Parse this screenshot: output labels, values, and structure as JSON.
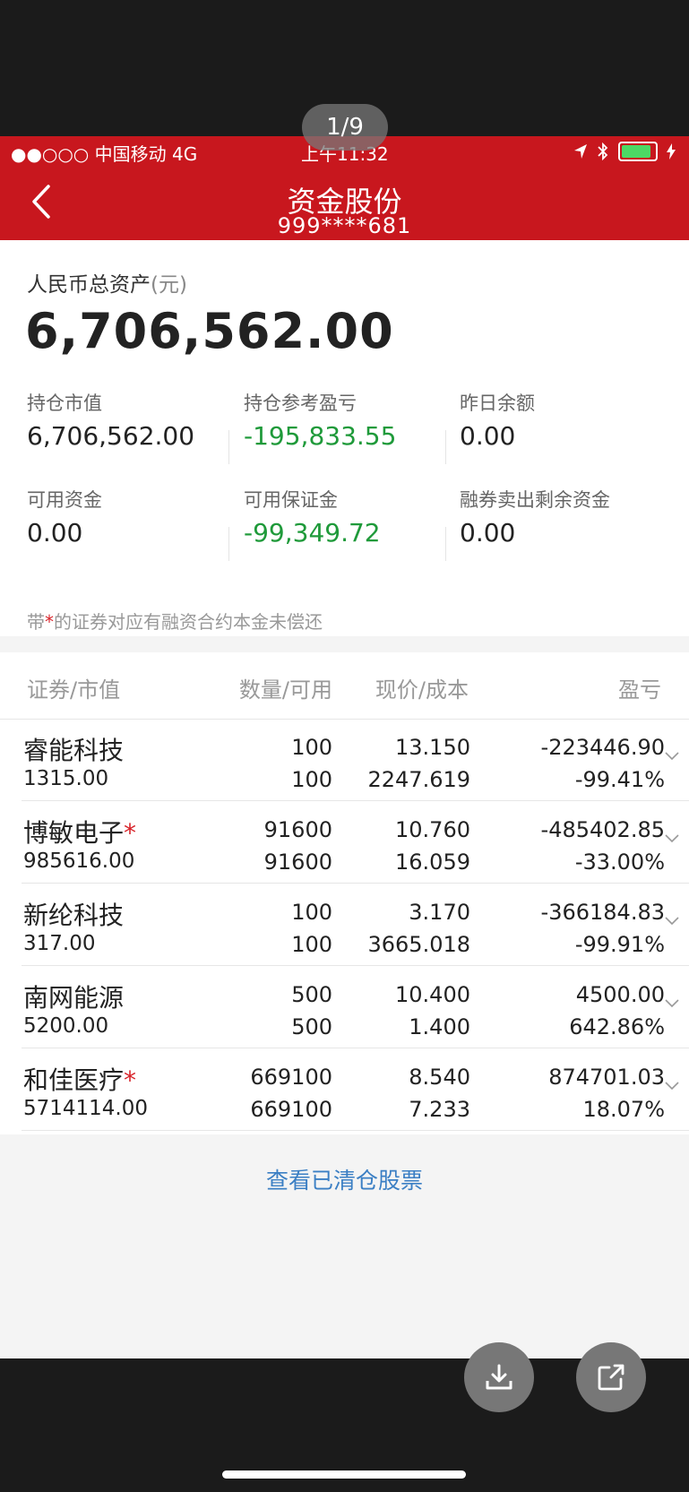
{
  "viewer": {
    "page_indicator": "1/9"
  },
  "status_bar": {
    "carrier": "●●○○○ 中国移动   4G",
    "time": "上午11:32",
    "battery_level": 0.9
  },
  "header": {
    "title": "资金股份",
    "account": "999****681"
  },
  "assets": {
    "total_label": "人民币总资产",
    "total_unit": "(元)",
    "total_value": "6,706,562.00",
    "grid": [
      {
        "label": "持仓市值",
        "value": "6,706,562.00",
        "color": "default"
      },
      {
        "label": "持仓参考盈亏",
        "value": "-195,833.55",
        "color": "green"
      },
      {
        "label": "昨日余额",
        "value": "0.00",
        "color": "default"
      },
      {
        "label": "可用资金",
        "value": "0.00",
        "color": "default"
      },
      {
        "label": "可用保证金",
        "value": "-99,349.72",
        "color": "green"
      },
      {
        "label": "融券卖出剩余资金",
        "value": "0.00",
        "color": "default"
      }
    ],
    "note_prefix": "带",
    "note_star": "*",
    "note_suffix": "的证券对应有融资合约本金未偿还"
  },
  "table": {
    "headers": {
      "security": "证券/市值",
      "quantity": "数量/可用",
      "price": "现价/成本",
      "profit": "盈亏"
    },
    "rows": [
      {
        "name": "睿能科技",
        "star": "",
        "market_value": "1315.00",
        "quantity": "100",
        "available": "100",
        "price": "13.150",
        "cost": "2247.619",
        "profit": "-223446.90",
        "profit_pct": "-99.41%",
        "trend": "green"
      },
      {
        "name": "博敏电子",
        "star": "*",
        "market_value": "985616.00",
        "quantity": "91600",
        "available": "91600",
        "price": "10.760",
        "cost": "16.059",
        "profit": "-485402.85",
        "profit_pct": "-33.00%",
        "trend": "green"
      },
      {
        "name": "新纶科技",
        "star": "",
        "market_value": "317.00",
        "quantity": "100",
        "available": "100",
        "price": "3.170",
        "cost": "3665.018",
        "profit": "-366184.83",
        "profit_pct": "-99.91%",
        "trend": "green"
      },
      {
        "name": "南网能源",
        "star": "",
        "market_value": "5200.00",
        "quantity": "500",
        "available": "500",
        "price": "10.400",
        "cost": "1.400",
        "profit": "4500.00",
        "profit_pct": "642.86%",
        "trend": "red"
      },
      {
        "name": "和佳医疗",
        "star": "*",
        "market_value": "5714114.00",
        "quantity": "669100",
        "available": "669100",
        "price": "8.540",
        "cost": "7.233",
        "profit": "874701.03",
        "profit_pct": "18.07%",
        "trend": "red"
      }
    ]
  },
  "cleared_link": "查看已清仓股票",
  "colors": {
    "header_red": "#c8171e",
    "gain_red": "#d8232a",
    "loss_green": "#1f9a3a",
    "link_blue": "#3b7fc4"
  },
  "icons": {
    "back": "back-chevron-icon",
    "download": "download-icon",
    "share": "share-icon",
    "expand": "chevron-down-icon"
  }
}
